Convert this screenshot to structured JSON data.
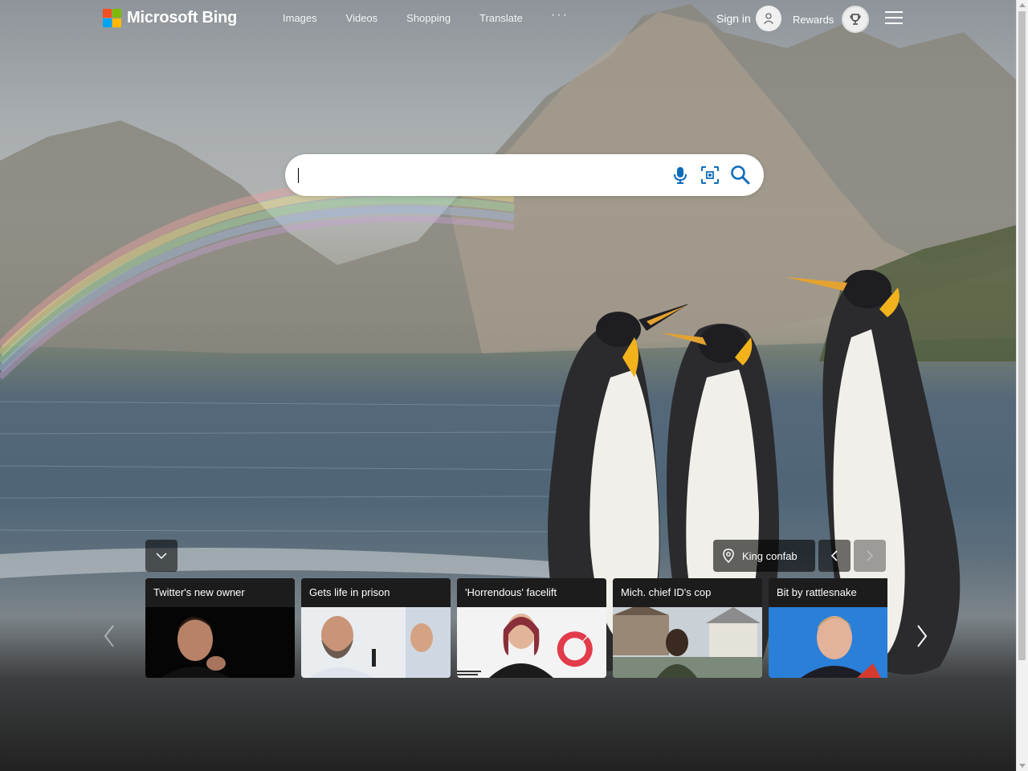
{
  "header": {
    "logo_text": "Microsoft Bing",
    "nav": [
      {
        "label": "Images"
      },
      {
        "label": "Videos"
      },
      {
        "label": "Shopping"
      },
      {
        "label": "Translate"
      }
    ],
    "more_label": "···",
    "signin_label": "Sign in",
    "rewards_label": "Rewards"
  },
  "search": {
    "value": "",
    "placeholder": ""
  },
  "image_of_day": {
    "location_label": "King confab"
  },
  "news": [
    {
      "title": "Twitter's new owner"
    },
    {
      "title": "Gets life in prison"
    },
    {
      "title": "'Horrendous' facelift"
    },
    {
      "title": "Mich. chief ID's cop"
    },
    {
      "title": "Bit by rattlesnake"
    }
  ],
  "colors": {
    "accent": "#174ae4",
    "search_icon": "#0f6cbd"
  },
  "icons": {
    "mic": "microphone-icon",
    "visual_search": "visual-search-icon",
    "search": "search-icon",
    "menu": "hamburger-icon"
  }
}
